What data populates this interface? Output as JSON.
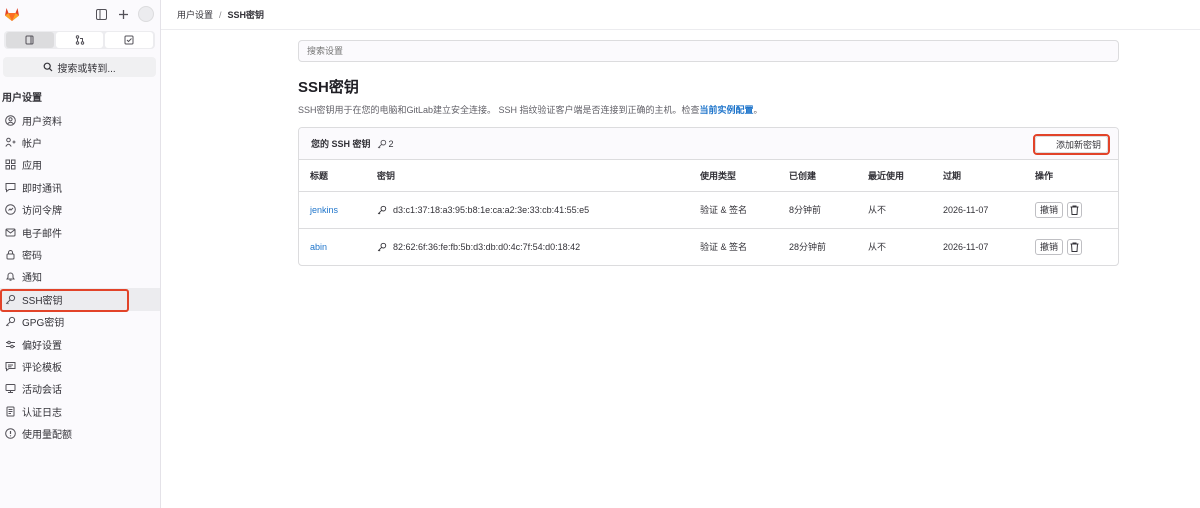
{
  "sidebar": {
    "search_label": "搜索或转到...",
    "section_title": "用户设置",
    "items": [
      {
        "label": "用户资料",
        "icon": "profile-icon"
      },
      {
        "label": "帐户",
        "icon": "account-icon"
      },
      {
        "label": "应用",
        "icon": "applications-icon"
      },
      {
        "label": "即时通讯",
        "icon": "chat-icon"
      },
      {
        "label": "访问令牌",
        "icon": "token-icon"
      },
      {
        "label": "电子邮件",
        "icon": "email-icon"
      },
      {
        "label": "密码",
        "icon": "lock-icon"
      },
      {
        "label": "通知",
        "icon": "bell-icon"
      },
      {
        "label": "SSH密钥",
        "icon": "key-icon",
        "active": true
      },
      {
        "label": "GPG密钥",
        "icon": "key-icon"
      },
      {
        "label": "偏好设置",
        "icon": "preferences-icon"
      },
      {
        "label": "评论模板",
        "icon": "comment-icon"
      },
      {
        "label": "活动会话",
        "icon": "sessions-icon"
      },
      {
        "label": "认证日志",
        "icon": "log-icon"
      },
      {
        "label": "使用量配额",
        "icon": "quota-icon"
      }
    ]
  },
  "breadcrumb": {
    "parent": "用户设置",
    "separator": "/",
    "current": "SSH密钥"
  },
  "main": {
    "search_placeholder": "搜索设置",
    "title": "SSH密钥",
    "desc_text": "SSH密钥用于在您的电脑和GitLab建立安全连接。 SSH 指纹验证客户端是否连接到正确的主机。检查",
    "desc_link": "当前实例配置",
    "desc_end": "。",
    "card": {
      "title": "您的 SSH 密钥",
      "count": "2",
      "add_button": "添加新密钥",
      "columns": [
        "标题",
        "密钥",
        "使用类型",
        "已创建",
        "最近使用",
        "过期",
        "操作"
      ],
      "rows": [
        {
          "title": "jenkins",
          "key": "d3:c1:37:18:a3:95:b8:1e:ca:a2:3e:33:cb:41:55:e5",
          "usage": "验证 & 签名",
          "created": "8分钟前",
          "last_used": "从不",
          "expires": "2026-11-07",
          "revoke": "撤销"
        },
        {
          "title": "abin",
          "key": "82:62:6f:36:fe:fb:5b:d3:db:d0:4c:7f:54:d0:18:42",
          "usage": "验证 & 签名",
          "created": "28分钟前",
          "last_used": "从不",
          "expires": "2026-11-07",
          "revoke": "撤销"
        }
      ]
    }
  },
  "colors": {
    "accent": "#e24329",
    "link": "#1f75cb"
  }
}
